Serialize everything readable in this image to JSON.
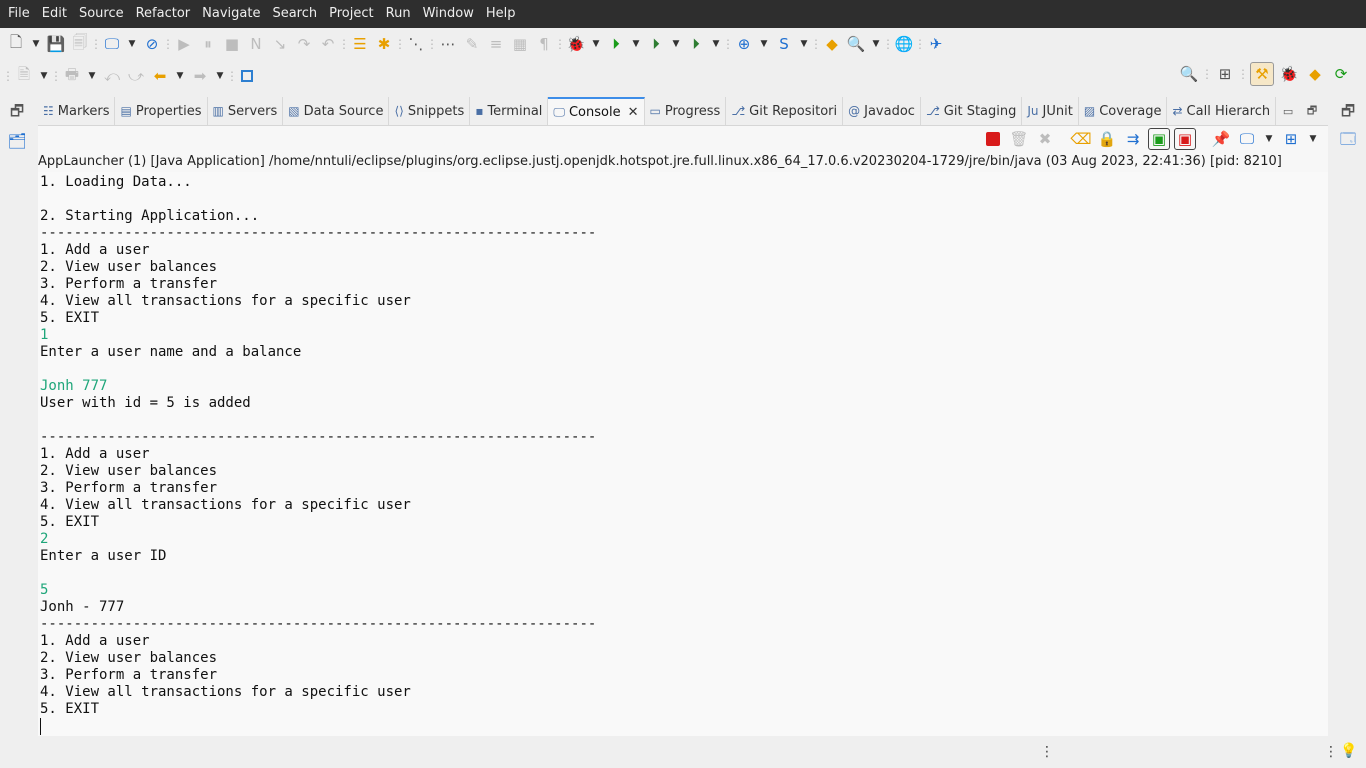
{
  "menubar": {
    "items": [
      "File",
      "Edit",
      "Source",
      "Refactor",
      "Navigate",
      "Search",
      "Project",
      "Run",
      "Window",
      "Help"
    ]
  },
  "views": {
    "tabs": [
      {
        "label": "Markers",
        "icon": "markers-icon"
      },
      {
        "label": "Properties",
        "icon": "properties-icon"
      },
      {
        "label": "Servers",
        "icon": "servers-icon"
      },
      {
        "label": "Data Source",
        "icon": "data-source-icon"
      },
      {
        "label": "Snippets",
        "icon": "snippets-icon"
      },
      {
        "label": "Terminal",
        "icon": "terminal-icon"
      },
      {
        "label": "Console",
        "icon": "console-icon",
        "active": true
      },
      {
        "label": "Progress",
        "icon": "progress-icon"
      },
      {
        "label": "Git Repositori",
        "icon": "git-icon"
      },
      {
        "label": "Javadoc",
        "icon": "javadoc-icon"
      },
      {
        "label": "Git Staging",
        "icon": "git-staging-icon"
      },
      {
        "label": "JUnit",
        "icon": "junit-icon"
      },
      {
        "label": "Coverage",
        "icon": "coverage-icon"
      },
      {
        "label": "Call Hierarch",
        "icon": "call-hierarchy-icon"
      }
    ]
  },
  "console": {
    "label": "AppLauncher (1) [Java Application] /home/nntuli/eclipse/plugins/org.eclipse.justj.openjdk.hotspot.jre.full.linux.x86_64_17.0.6.v20230204-1729/jre/bin/java  (03 Aug 2023, 22:41:36) [pid: 8210]",
    "lines": [
      {
        "text": "1. Loading Data...",
        "input": false
      },
      {
        "text": "",
        "input": false
      },
      {
        "text": "2. Starting Application...",
        "input": false
      },
      {
        "text": "------------------------------------------------------------------",
        "input": false
      },
      {
        "text": "1. Add a user",
        "input": false
      },
      {
        "text": "2. View user balances",
        "input": false
      },
      {
        "text": "3. Perform a transfer",
        "input": false
      },
      {
        "text": "4. View all transactions for a specific user",
        "input": false
      },
      {
        "text": "5. EXIT",
        "input": false
      },
      {
        "text": "1",
        "input": true
      },
      {
        "text": "Enter a user name and a balance",
        "input": false
      },
      {
        "text": "",
        "input": false
      },
      {
        "text": "Jonh 777",
        "input": true
      },
      {
        "text": "User with id = 5 is added",
        "input": false
      },
      {
        "text": "",
        "input": false
      },
      {
        "text": "------------------------------------------------------------------",
        "input": false
      },
      {
        "text": "1. Add a user",
        "input": false
      },
      {
        "text": "2. View user balances",
        "input": false
      },
      {
        "text": "3. Perform a transfer",
        "input": false
      },
      {
        "text": "4. View all transactions for a specific user",
        "input": false
      },
      {
        "text": "5. EXIT",
        "input": false
      },
      {
        "text": "2",
        "input": true
      },
      {
        "text": "Enter a user ID",
        "input": false
      },
      {
        "text": "",
        "input": false
      },
      {
        "text": "5",
        "input": true
      },
      {
        "text": "Jonh - 777",
        "input": false
      },
      {
        "text": "------------------------------------------------------------------",
        "input": false
      },
      {
        "text": "1. Add a user",
        "input": false
      },
      {
        "text": "2. View user balances",
        "input": false
      },
      {
        "text": "3. Perform a transfer",
        "input": false
      },
      {
        "text": "4. View all transactions for a specific user",
        "input": false
      },
      {
        "text": "5. EXIT",
        "input": false
      }
    ]
  },
  "colors": {
    "menubar_bg": "#2e2e2e",
    "active_tab_accent": "#3d8de8",
    "console_input": "#1fa67a",
    "stop_button": "#d81b1b"
  }
}
